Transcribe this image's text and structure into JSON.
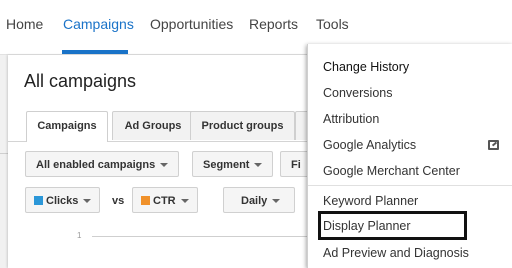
{
  "nav": {
    "items": [
      {
        "label": "Home"
      },
      {
        "label": "Campaigns"
      },
      {
        "label": "Opportunities"
      },
      {
        "label": "Reports"
      },
      {
        "label": "Tools"
      }
    ],
    "active": "Campaigns"
  },
  "main": {
    "title": "All campaigns",
    "tabs": [
      {
        "label": "Campaigns"
      },
      {
        "label": "Ad Groups"
      },
      {
        "label": "Product groups"
      }
    ],
    "filter_label": "All enabled campaigns",
    "segment_label": "Segment",
    "filter_partial_label": "Fi",
    "metric1": {
      "label": "Clicks",
      "color": "#2b97d8"
    },
    "vs_label": "vs",
    "metric2": {
      "label": "CTR",
      "color": "#f0912a"
    },
    "interval_label": "Daily",
    "axis_tick": "1"
  },
  "tools_menu": {
    "items": [
      {
        "label": "Change History"
      },
      {
        "label": "Conversions"
      },
      {
        "label": "Attribution"
      },
      {
        "label": "Google Analytics",
        "icon": "external-link-icon"
      },
      {
        "label": "Google Merchant Center"
      },
      {
        "label": "Keyword Planner"
      },
      {
        "label": "Display Planner",
        "highlighted": true
      },
      {
        "label": "Ad Preview and Diagnosis"
      }
    ]
  }
}
